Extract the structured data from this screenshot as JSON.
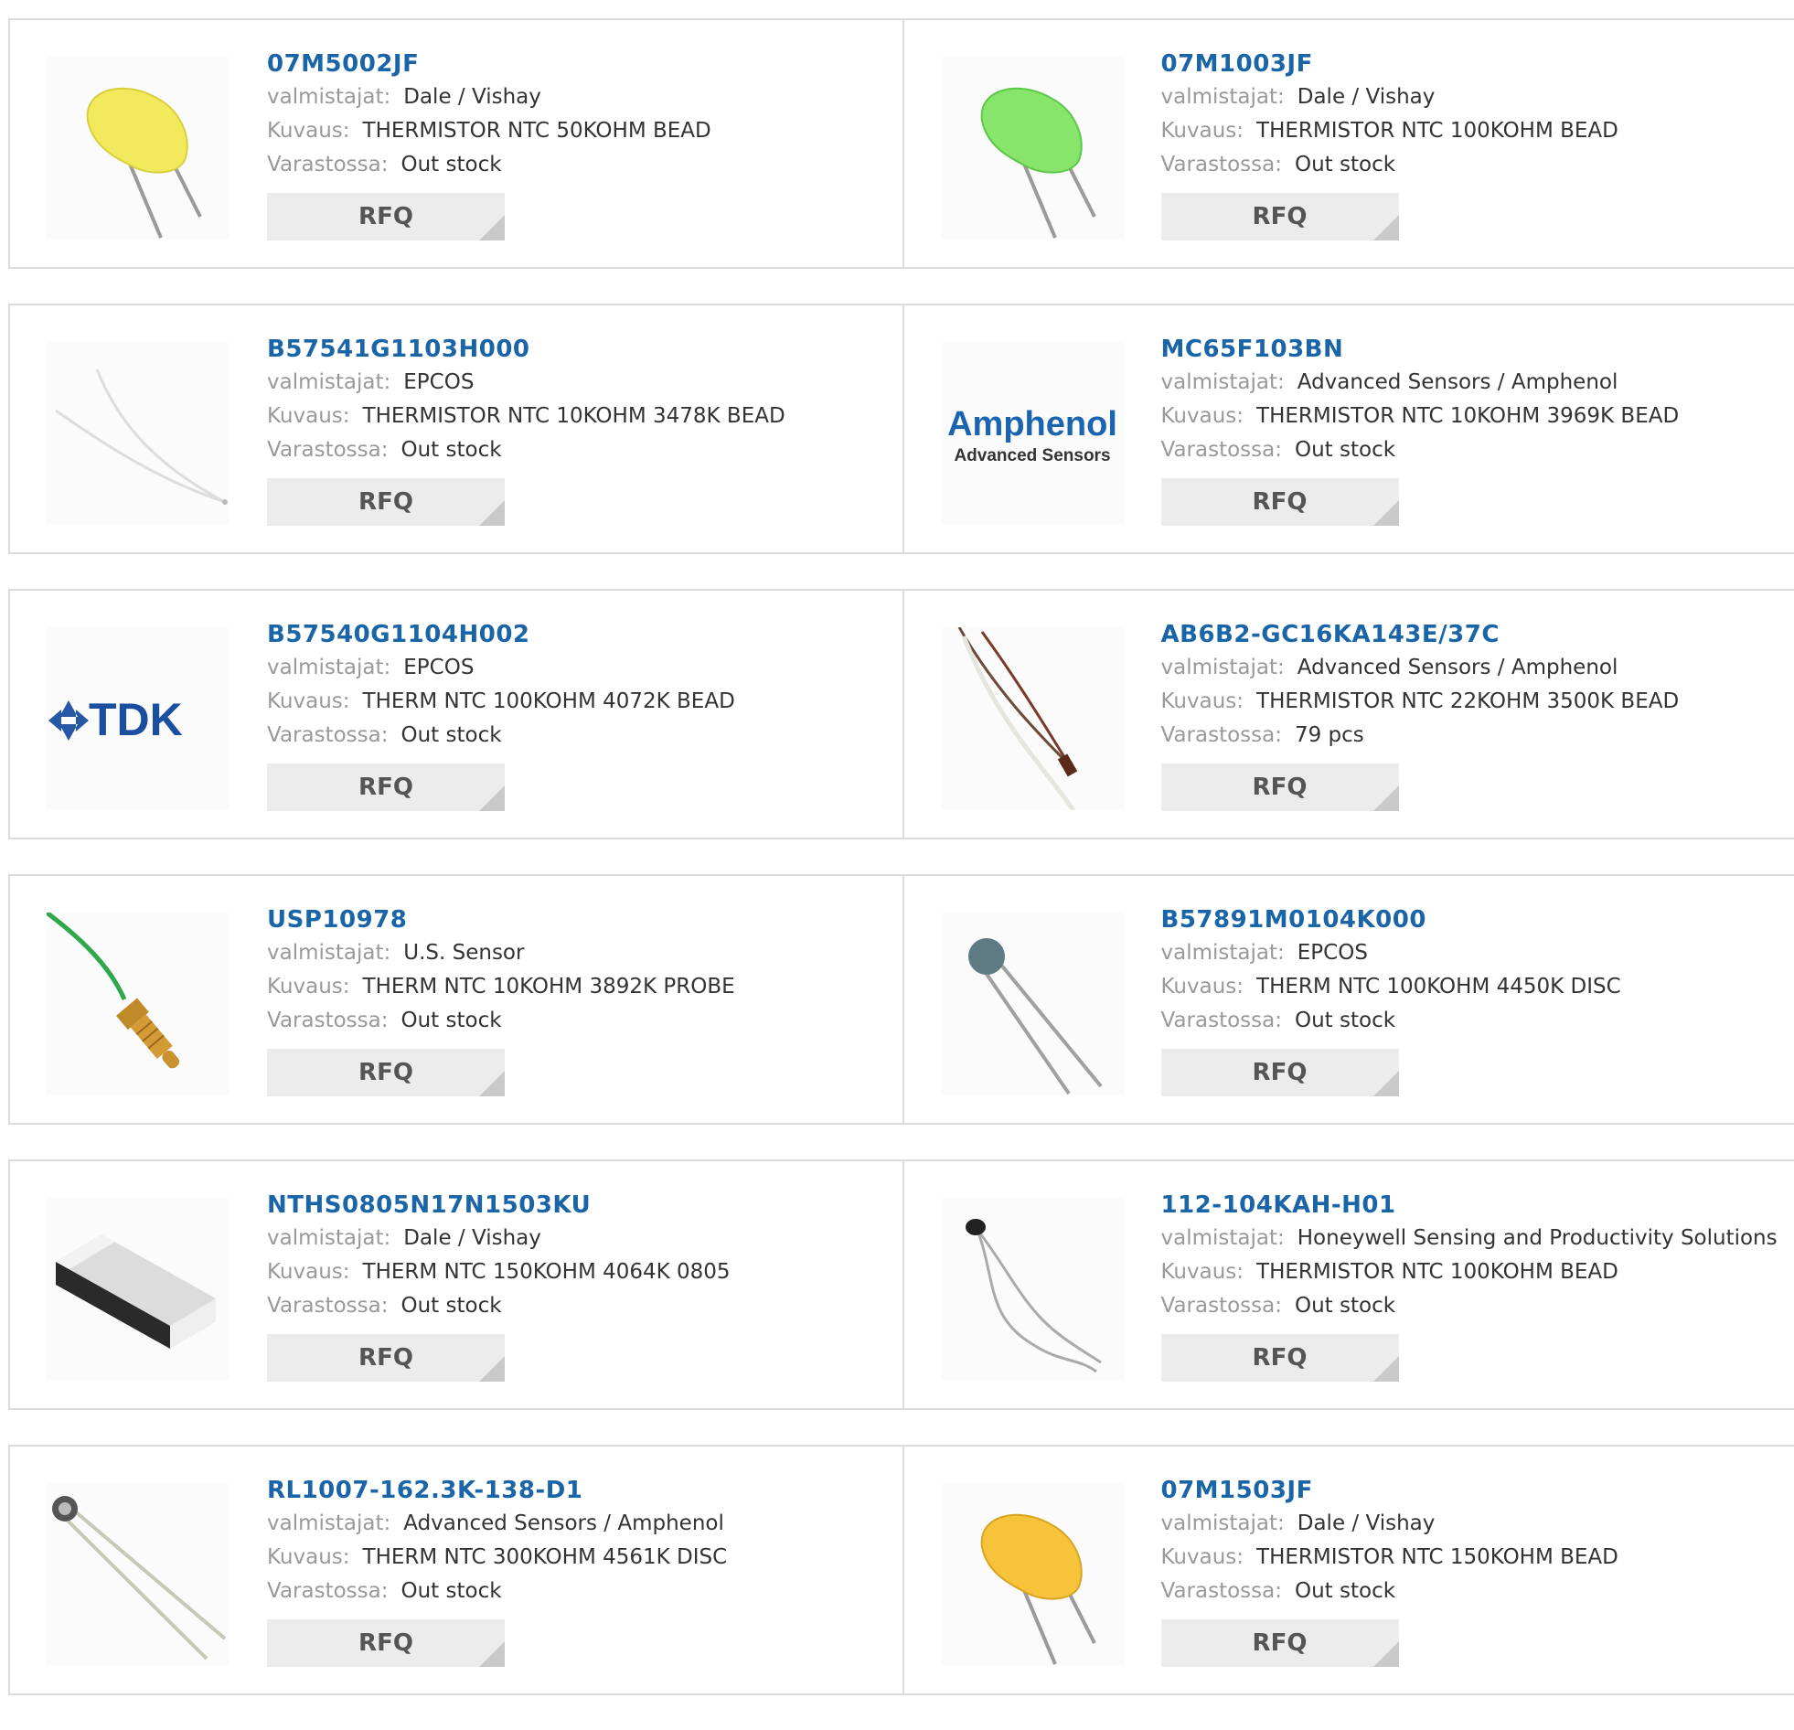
{
  "labels": {
    "manufacturer": "valmistajat:",
    "description": "Kuvaus:",
    "stock": "Varastossa:",
    "rfq": "RFQ"
  },
  "products": [
    {
      "part": "07M5002JF",
      "manufacturer": "Dale / Vishay",
      "description": "THERMISTOR NTC 50KOHM BEAD",
      "stock": "Out stock",
      "image": "yellow-bead-thermistor"
    },
    {
      "part": "07M1003JF",
      "manufacturer": "Dale / Vishay",
      "description": "THERMISTOR NTC 100KOHM BEAD",
      "stock": "Out stock",
      "image": "green-bead-thermistor"
    },
    {
      "part": "B57541G1103H000",
      "manufacturer": "EPCOS",
      "description": "THERMISTOR NTC 10KOHM 3478K BEAD",
      "stock": "Out stock",
      "image": "wire-bead-thermistor"
    },
    {
      "part": "MC65F103BN",
      "manufacturer": "Advanced Sensors / Amphenol",
      "description": "THERMISTOR NTC 10KOHM 3969K BEAD",
      "stock": "Out stock",
      "image": "amphenol-logo",
      "logo_text": [
        "Amphenol",
        "Advanced Sensors"
      ]
    },
    {
      "part": "B57540G1104H002",
      "manufacturer": "EPCOS",
      "description": "THERM NTC 100KOHM 4072K BEAD",
      "stock": "Out stock",
      "image": "tdk-logo",
      "logo_text": [
        "TDK"
      ]
    },
    {
      "part": "AB6B2-GC16KA143E/37C",
      "manufacturer": "Advanced Sensors / Amphenol",
      "description": "THERMISTOR NTC 22KOHM 3500K BEAD",
      "stock": "79 pcs",
      "image": "wire-probe-thermistor"
    },
    {
      "part": "USP10978",
      "manufacturer": "U.S. Sensor",
      "description": "THERM NTC 10KOHM 3892K PROBE",
      "stock": "Out stock",
      "image": "brass-probe-thermistor"
    },
    {
      "part": "B57891M0104K000",
      "manufacturer": "EPCOS",
      "description": "THERM NTC 100KOHM 4450K DISC",
      "stock": "Out stock",
      "image": "disc-thermistor"
    },
    {
      "part": "NTHS0805N17N1503KU",
      "manufacturer": "Dale / Vishay",
      "description": "THERM NTC 150KOHM 4064K 0805",
      "stock": "Out stock",
      "image": "smd-chip-thermistor"
    },
    {
      "part": "112-104KAH-H01",
      "manufacturer": "Honeywell Sensing and Productivity Solutions",
      "description": "THERMISTOR NTC 100KOHM BEAD",
      "stock": "Out stock",
      "image": "glass-bead-thermistor"
    },
    {
      "part": "RL1007-162.3K-138-D1",
      "manufacturer": "Advanced Sensors / Amphenol",
      "description": "THERM NTC 300KOHM 4561K DISC",
      "stock": "Out stock",
      "image": "small-disc-thermistor"
    },
    {
      "part": "07M1503JF",
      "manufacturer": "Dale / Vishay",
      "description": "THERMISTOR NTC 150KOHM BEAD",
      "stock": "Out stock",
      "image": "orange-bead-thermistor"
    }
  ]
}
